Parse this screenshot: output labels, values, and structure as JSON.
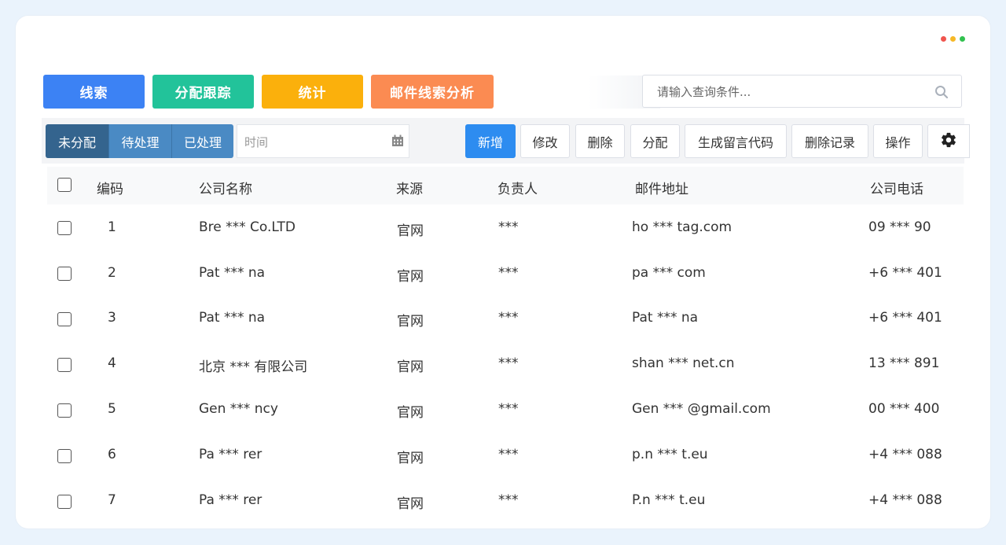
{
  "tabs": {
    "clues": "线索",
    "assign_track": "分配跟踪",
    "stats": "统计",
    "email_analysis": "邮件线索分析"
  },
  "search": {
    "placeholder": "请输入查询条件..."
  },
  "status_filter": {
    "unassigned": "未分配",
    "pending": "待处理",
    "processed": "已处理"
  },
  "date_filter": {
    "placeholder": "时间"
  },
  "actions": {
    "add": "新增",
    "edit": "修改",
    "delete": "删除",
    "assign": "分配",
    "gen_code": "生成留言代码",
    "delete_records": "删除记录",
    "operate": "操作"
  },
  "table": {
    "columns": [
      "编码",
      "公司名称",
      "来源",
      "负责人",
      "邮件地址",
      "公司电话"
    ],
    "rows": [
      {
        "id": "1",
        "company": "Bre *** Co.LTD",
        "source": "官网",
        "owner": "***",
        "email": "ho *** tag.com",
        "phone": "09 *** 90"
      },
      {
        "id": "2",
        "company": "Pat *** na",
        "source": "官网",
        "owner": "***",
        "email": "pa *** com",
        "phone": "+6 *** 401"
      },
      {
        "id": "3",
        "company": "Pat *** na",
        "source": "官网",
        "owner": "***",
        "email": "Pat *** na",
        "phone": "+6 *** 401"
      },
      {
        "id": "4",
        "company": "北京 *** 有限公司",
        "source": "官网",
        "owner": "***",
        "email": "shan *** net.cn",
        "phone": "13 *** 891"
      },
      {
        "id": "5",
        "company": "Gen *** ncy",
        "source": "官网",
        "owner": "***",
        "email": "Gen *** @gmail.com",
        "phone": "00 *** 400"
      },
      {
        "id": "6",
        "company": "Pa *** rer",
        "source": "官网",
        "owner": "***",
        "email": "p.n *** t.eu",
        "phone": "+4 *** 088"
      },
      {
        "id": "7",
        "company": "Pa *** rer",
        "source": "官网",
        "owner": "***",
        "email": "P.n *** t.eu",
        "phone": "+4 *** 088"
      }
    ]
  },
  "colors": {
    "tab_clues": "#3c82f4",
    "tab_assign": "#22c39a",
    "tab_stats": "#fbb00c",
    "tab_email": "#fb8b52",
    "seg_active": "#34648e",
    "seg": "#4a8ac4",
    "primary": "#2d8cf0"
  },
  "icons": [
    "search-icon",
    "calendar-icon",
    "gear-icon",
    "window-dots"
  ]
}
